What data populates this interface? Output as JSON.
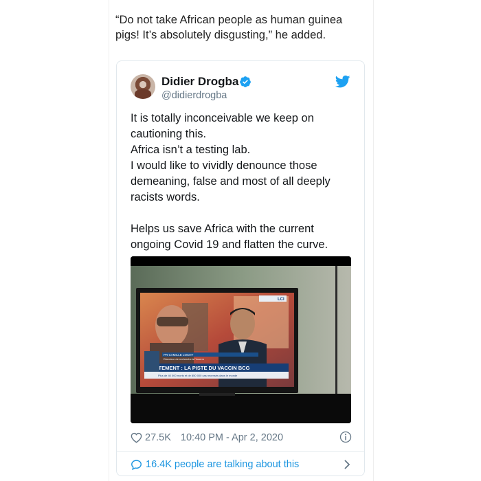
{
  "article": {
    "quote": "“Do not take African people as human guinea pigs! It’s absolutely disgusting,” he added."
  },
  "tweet": {
    "author": {
      "name": "Didier Drogba",
      "handle": "@didierdrogba",
      "avatar_icon": "profile-photo",
      "verified_icon": "verified-badge-icon",
      "verified_color": "#1da1f2"
    },
    "platform_icon": "twitter-bird-icon",
    "body": [
      "It is totally inconceivable we keep on cautioning this.",
      "Africa isn’t a testing lab.",
      "I would like to vividly denounce those demeaning, false and most of all deeply racists words.",
      "",
      "Helps us save Africa with the current ongoing Covid 19 and flatten the curve."
    ],
    "media": {
      "channel": "LCI",
      "lower_third_name": "PR CAMILLE LOCHT",
      "lower_third_title": "Directeur de recherche à l'Inserm",
      "headline": "TRAITEMENT : LA PISTE DU VACCIN BCG",
      "ticker": "Plus de 40 000 morts et de 850 000 cas recensés dans le monde"
    },
    "likes": "27.5K",
    "timestamp": "10:40 PM - Apr 2, 2020",
    "talking": "16.4K people are talking about this",
    "colors": {
      "link": "#1b95e0",
      "meta": "#657786"
    }
  }
}
